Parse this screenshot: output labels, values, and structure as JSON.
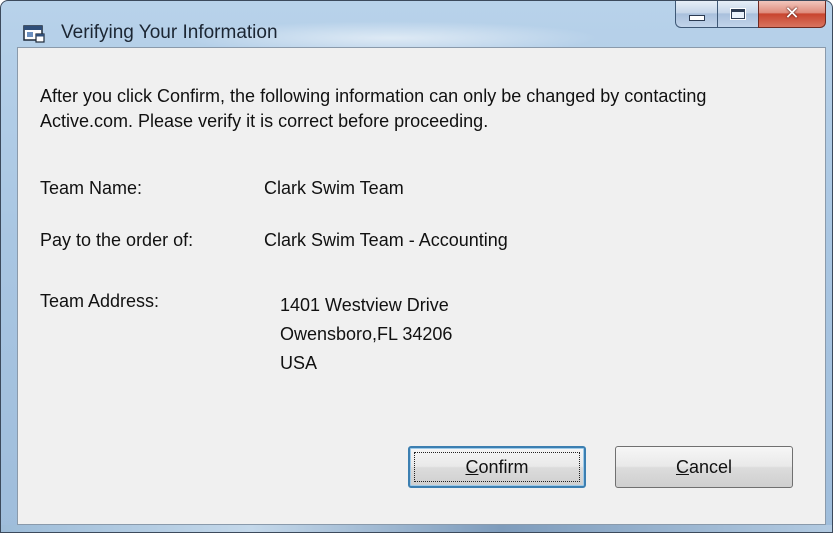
{
  "window": {
    "title": "Verifying Your Information",
    "icon": "application-window-icon",
    "caption_buttons": [
      "minimize",
      "maximize",
      "close"
    ]
  },
  "dialog": {
    "intro_text": "After you click Confirm, the following information can only be changed by contacting Active.com. Please verify it is correct before proceeding.",
    "fields": {
      "team_name": {
        "label": "Team Name:",
        "value": "Clark Swim Team"
      },
      "pay_to": {
        "label": "Pay to the order of:",
        "value": "Clark Swim Team - Accounting"
      },
      "team_address": {
        "label": "Team Address:",
        "line1": "1401 Westview Drive",
        "line2": "Owensboro,FL 34206",
        "line3": "USA"
      }
    },
    "buttons": {
      "confirm": {
        "accel": "C",
        "rest": "onfirm"
      },
      "cancel": {
        "accel": "C",
        "rest": "ancel"
      }
    }
  },
  "colors": {
    "title_bar": "#a9c6e2",
    "client_background": "#f0f0f0",
    "close_button": "#c8452f",
    "default_button_border": "#3c7fb1"
  }
}
